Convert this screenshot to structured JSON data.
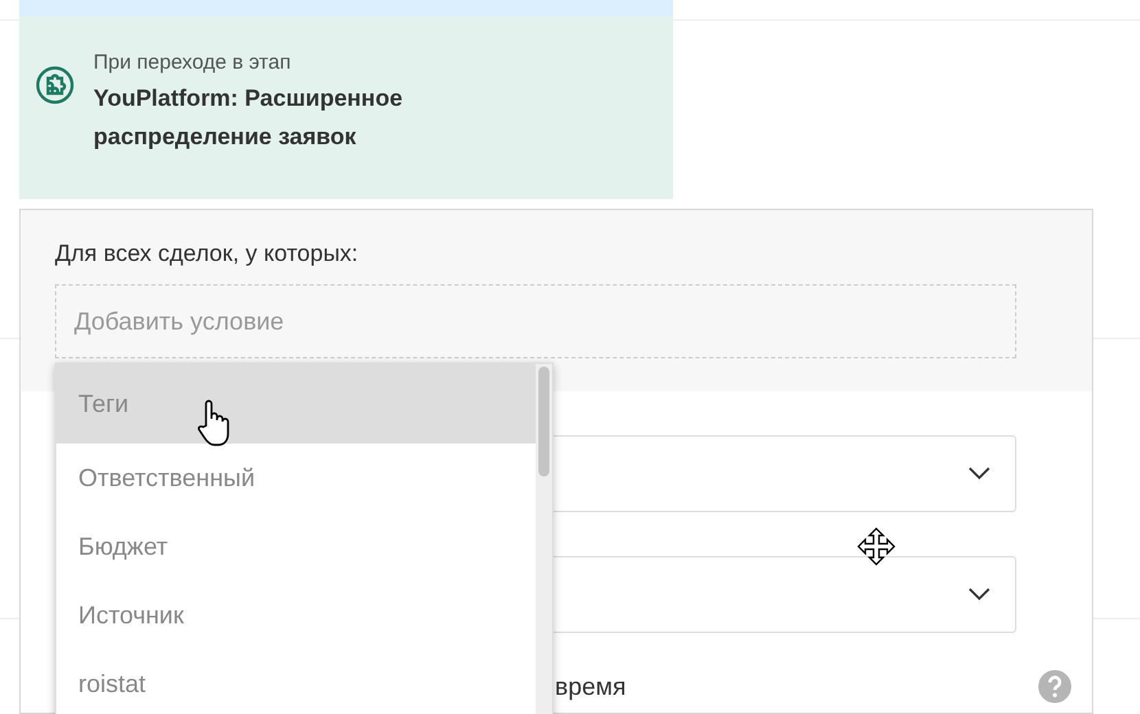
{
  "trigger": {
    "caption": "При переходе в этап",
    "title": "YouPlatform: Расширенное распределение заявок"
  },
  "popup": {
    "label": "Для всех сделок, у которых:",
    "condition": {
      "placeholder": "Добавить условие"
    },
    "selects": [
      {
        "expanded": false
      },
      {
        "expanded": false
      }
    ],
    "option_label": "время"
  },
  "dropdown": {
    "items": [
      {
        "label": "Теги",
        "selected": true
      },
      {
        "label": "Ответственный",
        "selected": false
      },
      {
        "label": "Бюджет",
        "selected": false
      },
      {
        "label": "Источник",
        "selected": false
      },
      {
        "label": "roistat",
        "selected": false
      }
    ]
  }
}
